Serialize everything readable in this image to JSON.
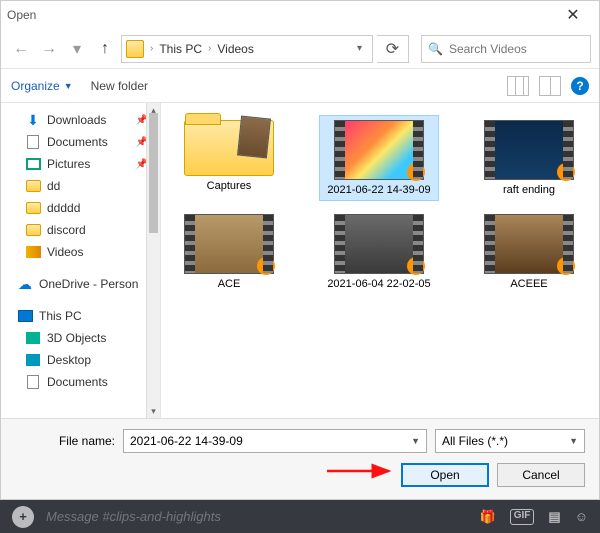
{
  "title": "Open",
  "breadcrumb": {
    "root": "This PC",
    "folder": "Videos"
  },
  "search": {
    "placeholder": "Search Videos"
  },
  "toolbar": {
    "organize": "Organize",
    "newfolder": "New folder"
  },
  "sidebar": {
    "downloads": "Downloads",
    "documents": "Documents",
    "pictures": "Pictures",
    "dd": "dd",
    "ddddd": "ddddd",
    "discord": "discord",
    "videos": "Videos",
    "onedrive": "OneDrive - Person",
    "thispc": "This PC",
    "threed": "3D Objects",
    "desktop": "Desktop",
    "documents2": "Documents"
  },
  "items": {
    "captures": "Captures",
    "sel": "2021-06-22 14-39-09",
    "raft": "raft ending",
    "ace": "ACE",
    "jun04": "2021-06-04 22-02-05",
    "aceee": "ACEEE"
  },
  "footer": {
    "filename_label": "File name:",
    "filename_value": "2021-06-22 14-39-09",
    "filter": "All Files (*.*)",
    "open": "Open",
    "cancel": "Cancel"
  },
  "discord": {
    "placeholder": "Message #clips-and-highlights",
    "gif": "GIF"
  }
}
